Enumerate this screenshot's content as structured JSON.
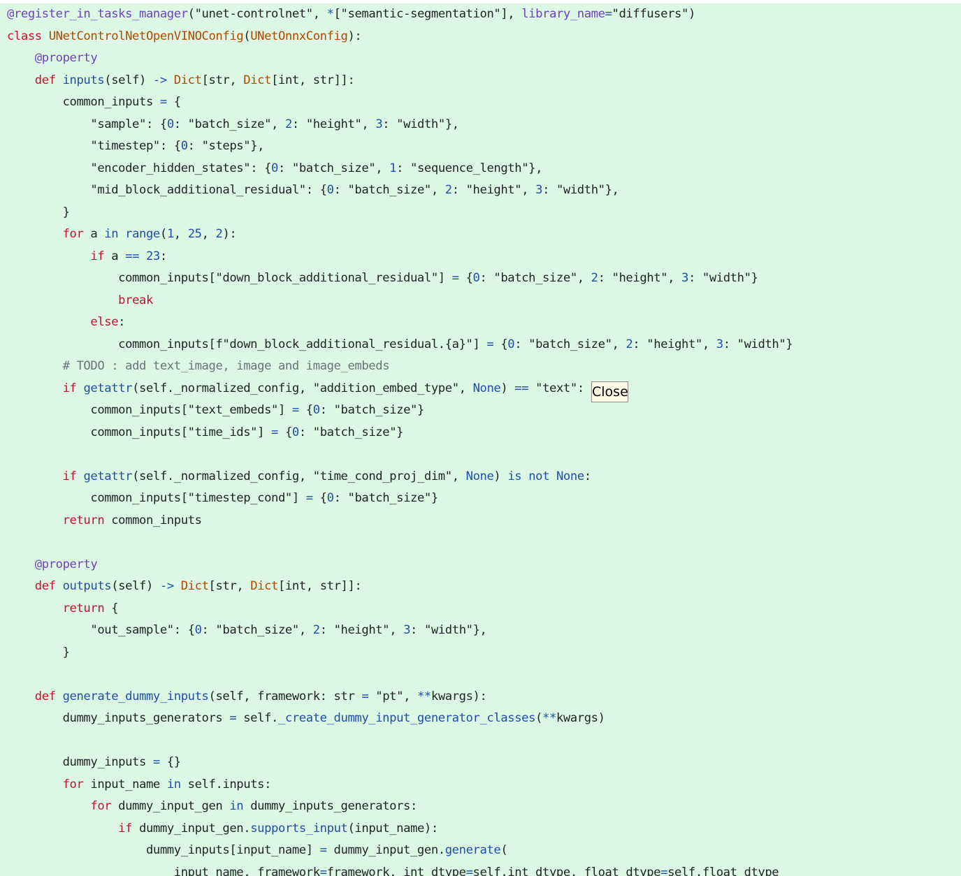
{
  "code": {
    "language": "python",
    "lines": [
      [
        {
          "t": "@register_in_tasks_manager",
          "k": "dec"
        },
        {
          "t": "(",
          "k": "txt"
        },
        {
          "t": "\"unet-controlnet\"",
          "k": "str"
        },
        {
          "t": ", ",
          "k": "txt"
        },
        {
          "t": "*",
          "k": "op"
        },
        {
          "t": "[",
          "k": "txt"
        },
        {
          "t": "\"semantic-segmentation\"",
          "k": "str"
        },
        {
          "t": "], ",
          "k": "txt"
        },
        {
          "t": "library_name",
          "k": "dec"
        },
        {
          "t": "=",
          "k": "op"
        },
        {
          "t": "\"diffusers\"",
          "k": "str"
        },
        {
          "t": ")",
          "k": "txt"
        }
      ],
      [
        {
          "t": "class ",
          "k": "kw"
        },
        {
          "t": "UNetControlNetOpenVINOConfig",
          "k": "cls"
        },
        {
          "t": "(",
          "k": "txt"
        },
        {
          "t": "UNetOnnxConfig",
          "k": "cls"
        },
        {
          "t": "):",
          "k": "txt"
        }
      ],
      [
        {
          "t": "    ",
          "k": "txt"
        },
        {
          "t": "@property",
          "k": "dec"
        }
      ],
      [
        {
          "t": "    ",
          "k": "txt"
        },
        {
          "t": "def ",
          "k": "kw"
        },
        {
          "t": "inputs",
          "k": "bi"
        },
        {
          "t": "(self) ",
          "k": "txt"
        },
        {
          "t": "->",
          "k": "op"
        },
        {
          "t": " ",
          "k": "txt"
        },
        {
          "t": "Dict",
          "k": "cls"
        },
        {
          "t": "[str, ",
          "k": "txt"
        },
        {
          "t": "Dict",
          "k": "cls"
        },
        {
          "t": "[int, str]]:",
          "k": "txt"
        }
      ],
      [
        {
          "t": "        common_inputs ",
          "k": "txt"
        },
        {
          "t": "=",
          "k": "op"
        },
        {
          "t": " {",
          "k": "txt"
        }
      ],
      [
        {
          "t": "            ",
          "k": "txt"
        },
        {
          "t": "\"sample\"",
          "k": "str"
        },
        {
          "t": ": {",
          "k": "txt"
        },
        {
          "t": "0",
          "k": "num"
        },
        {
          "t": ": ",
          "k": "txt"
        },
        {
          "t": "\"batch_size\"",
          "k": "str"
        },
        {
          "t": ", ",
          "k": "txt"
        },
        {
          "t": "2",
          "k": "num"
        },
        {
          "t": ": ",
          "k": "txt"
        },
        {
          "t": "\"height\"",
          "k": "str"
        },
        {
          "t": ", ",
          "k": "txt"
        },
        {
          "t": "3",
          "k": "num"
        },
        {
          "t": ": ",
          "k": "txt"
        },
        {
          "t": "\"width\"",
          "k": "str"
        },
        {
          "t": "},",
          "k": "txt"
        }
      ],
      [
        {
          "t": "            ",
          "k": "txt"
        },
        {
          "t": "\"timestep\"",
          "k": "str"
        },
        {
          "t": ": {",
          "k": "txt"
        },
        {
          "t": "0",
          "k": "num"
        },
        {
          "t": ": ",
          "k": "txt"
        },
        {
          "t": "\"steps\"",
          "k": "str"
        },
        {
          "t": "},",
          "k": "txt"
        }
      ],
      [
        {
          "t": "            ",
          "k": "txt"
        },
        {
          "t": "\"encoder_hidden_states\"",
          "k": "str"
        },
        {
          "t": ": {",
          "k": "txt"
        },
        {
          "t": "0",
          "k": "num"
        },
        {
          "t": ": ",
          "k": "txt"
        },
        {
          "t": "\"batch_size\"",
          "k": "str"
        },
        {
          "t": ", ",
          "k": "txt"
        },
        {
          "t": "1",
          "k": "num"
        },
        {
          "t": ": ",
          "k": "txt"
        },
        {
          "t": "\"sequence_length\"",
          "k": "str"
        },
        {
          "t": "},",
          "k": "txt"
        }
      ],
      [
        {
          "t": "            ",
          "k": "txt"
        },
        {
          "t": "\"mid_block_additional_residual\"",
          "k": "str"
        },
        {
          "t": ": {",
          "k": "txt"
        },
        {
          "t": "0",
          "k": "num"
        },
        {
          "t": ": ",
          "k": "txt"
        },
        {
          "t": "\"batch_size\"",
          "k": "str"
        },
        {
          "t": ", ",
          "k": "txt"
        },
        {
          "t": "2",
          "k": "num"
        },
        {
          "t": ": ",
          "k": "txt"
        },
        {
          "t": "\"height\"",
          "k": "str"
        },
        {
          "t": ", ",
          "k": "txt"
        },
        {
          "t": "3",
          "k": "num"
        },
        {
          "t": ": ",
          "k": "txt"
        },
        {
          "t": "\"width\"",
          "k": "str"
        },
        {
          "t": "},",
          "k": "txt"
        }
      ],
      [
        {
          "t": "        }",
          "k": "txt"
        }
      ],
      [
        {
          "t": "        ",
          "k": "txt"
        },
        {
          "t": "for",
          "k": "kw"
        },
        {
          "t": " a ",
          "k": "txt"
        },
        {
          "t": "in",
          "k": "op"
        },
        {
          "t": " ",
          "k": "txt"
        },
        {
          "t": "range",
          "k": "bi"
        },
        {
          "t": "(",
          "k": "txt"
        },
        {
          "t": "1",
          "k": "num"
        },
        {
          "t": ", ",
          "k": "txt"
        },
        {
          "t": "25",
          "k": "num"
        },
        {
          "t": ", ",
          "k": "txt"
        },
        {
          "t": "2",
          "k": "num"
        },
        {
          "t": "):",
          "k": "txt"
        }
      ],
      [
        {
          "t": "            ",
          "k": "txt"
        },
        {
          "t": "if",
          "k": "kw"
        },
        {
          "t": " a ",
          "k": "txt"
        },
        {
          "t": "==",
          "k": "op"
        },
        {
          "t": " ",
          "k": "txt"
        },
        {
          "t": "23",
          "k": "num"
        },
        {
          "t": ":",
          "k": "txt"
        }
      ],
      [
        {
          "t": "                common_inputs[",
          "k": "txt"
        },
        {
          "t": "\"down_block_additional_residual\"",
          "k": "str"
        },
        {
          "t": "] ",
          "k": "txt"
        },
        {
          "t": "=",
          "k": "op"
        },
        {
          "t": " {",
          "k": "txt"
        },
        {
          "t": "0",
          "k": "num"
        },
        {
          "t": ": ",
          "k": "txt"
        },
        {
          "t": "\"batch_size\"",
          "k": "str"
        },
        {
          "t": ", ",
          "k": "txt"
        },
        {
          "t": "2",
          "k": "num"
        },
        {
          "t": ": ",
          "k": "txt"
        },
        {
          "t": "\"height\"",
          "k": "str"
        },
        {
          "t": ", ",
          "k": "txt"
        },
        {
          "t": "3",
          "k": "num"
        },
        {
          "t": ": ",
          "k": "txt"
        },
        {
          "t": "\"width\"",
          "k": "str"
        },
        {
          "t": "}",
          "k": "txt"
        }
      ],
      [
        {
          "t": "                ",
          "k": "txt"
        },
        {
          "t": "break",
          "k": "kw"
        }
      ],
      [
        {
          "t": "            ",
          "k": "txt"
        },
        {
          "t": "else",
          "k": "kw"
        },
        {
          "t": ":",
          "k": "txt"
        }
      ],
      [
        {
          "t": "                common_inputs[",
          "k": "txt"
        },
        {
          "t": "f\"down_block_additional_residual.{a}\"",
          "k": "str"
        },
        {
          "t": "] ",
          "k": "txt"
        },
        {
          "t": "=",
          "k": "op"
        },
        {
          "t": " {",
          "k": "txt"
        },
        {
          "t": "0",
          "k": "num"
        },
        {
          "t": ": ",
          "k": "txt"
        },
        {
          "t": "\"batch_size\"",
          "k": "str"
        },
        {
          "t": ", ",
          "k": "txt"
        },
        {
          "t": "2",
          "k": "num"
        },
        {
          "t": ": ",
          "k": "txt"
        },
        {
          "t": "\"height\"",
          "k": "str"
        },
        {
          "t": ", ",
          "k": "txt"
        },
        {
          "t": "3",
          "k": "num"
        },
        {
          "t": ": ",
          "k": "txt"
        },
        {
          "t": "\"width\"",
          "k": "str"
        },
        {
          "t": "}",
          "k": "txt"
        }
      ],
      [
        {
          "t": "        ",
          "k": "txt"
        },
        {
          "t": "# TODO : add text_image, image and image_embeds",
          "k": "cmt"
        }
      ],
      [
        {
          "t": "        ",
          "k": "txt"
        },
        {
          "t": "if",
          "k": "kw"
        },
        {
          "t": " ",
          "k": "txt"
        },
        {
          "t": "getattr",
          "k": "bi"
        },
        {
          "t": "(self._normalized_config, ",
          "k": "txt"
        },
        {
          "t": "\"addition_embed_type\"",
          "k": "str"
        },
        {
          "t": ", ",
          "k": "txt"
        },
        {
          "t": "None",
          "k": "bi"
        },
        {
          "t": ") ",
          "k": "txt"
        },
        {
          "t": "==",
          "k": "op"
        },
        {
          "t": " ",
          "k": "txt"
        },
        {
          "t": "\"text\"",
          "k": "str"
        },
        {
          "t": ":",
          "k": "txt"
        }
      ],
      [
        {
          "t": "            common_inputs[",
          "k": "txt"
        },
        {
          "t": "\"text_embeds\"",
          "k": "str"
        },
        {
          "t": "] ",
          "k": "txt"
        },
        {
          "t": "=",
          "k": "op"
        },
        {
          "t": " {",
          "k": "txt"
        },
        {
          "t": "0",
          "k": "num"
        },
        {
          "t": ": ",
          "k": "txt"
        },
        {
          "t": "\"batch_size\"",
          "k": "str"
        },
        {
          "t": "}",
          "k": "txt"
        }
      ],
      [
        {
          "t": "            common_inputs[",
          "k": "txt"
        },
        {
          "t": "\"time_ids\"",
          "k": "str"
        },
        {
          "t": "] ",
          "k": "txt"
        },
        {
          "t": "=",
          "k": "op"
        },
        {
          "t": " {",
          "k": "txt"
        },
        {
          "t": "0",
          "k": "num"
        },
        {
          "t": ": ",
          "k": "txt"
        },
        {
          "t": "\"batch_size\"",
          "k": "str"
        },
        {
          "t": "}",
          "k": "txt"
        }
      ],
      [],
      [
        {
          "t": "        ",
          "k": "txt"
        },
        {
          "t": "if",
          "k": "kw"
        },
        {
          "t": " ",
          "k": "txt"
        },
        {
          "t": "getattr",
          "k": "bi"
        },
        {
          "t": "(self._normalized_config, ",
          "k": "txt"
        },
        {
          "t": "\"time_cond_proj_dim\"",
          "k": "str"
        },
        {
          "t": ", ",
          "k": "txt"
        },
        {
          "t": "None",
          "k": "bi"
        },
        {
          "t": ") ",
          "k": "txt"
        },
        {
          "t": "is",
          "k": "op"
        },
        {
          "t": " ",
          "k": "txt"
        },
        {
          "t": "not",
          "k": "op"
        },
        {
          "t": " ",
          "k": "txt"
        },
        {
          "t": "None",
          "k": "bi"
        },
        {
          "t": ":",
          "k": "txt"
        }
      ],
      [
        {
          "t": "            common_inputs[",
          "k": "txt"
        },
        {
          "t": "\"timestep_cond\"",
          "k": "str"
        },
        {
          "t": "] ",
          "k": "txt"
        },
        {
          "t": "=",
          "k": "op"
        },
        {
          "t": " {",
          "k": "txt"
        },
        {
          "t": "0",
          "k": "num"
        },
        {
          "t": ": ",
          "k": "txt"
        },
        {
          "t": "\"batch_size\"",
          "k": "str"
        },
        {
          "t": "}",
          "k": "txt"
        }
      ],
      [
        {
          "t": "        ",
          "k": "txt"
        },
        {
          "t": "return",
          "k": "kw"
        },
        {
          "t": " common_inputs",
          "k": "txt"
        }
      ],
      [],
      [
        {
          "t": "    ",
          "k": "txt"
        },
        {
          "t": "@property",
          "k": "dec"
        }
      ],
      [
        {
          "t": "    ",
          "k": "txt"
        },
        {
          "t": "def ",
          "k": "kw"
        },
        {
          "t": "outputs",
          "k": "bi"
        },
        {
          "t": "(self) ",
          "k": "txt"
        },
        {
          "t": "->",
          "k": "op"
        },
        {
          "t": " ",
          "k": "txt"
        },
        {
          "t": "Dict",
          "k": "cls"
        },
        {
          "t": "[str, ",
          "k": "txt"
        },
        {
          "t": "Dict",
          "k": "cls"
        },
        {
          "t": "[int, str]]:",
          "k": "txt"
        }
      ],
      [
        {
          "t": "        ",
          "k": "txt"
        },
        {
          "t": "return",
          "k": "kw"
        },
        {
          "t": " {",
          "k": "txt"
        }
      ],
      [
        {
          "t": "            ",
          "k": "txt"
        },
        {
          "t": "\"out_sample\"",
          "k": "str"
        },
        {
          "t": ": {",
          "k": "txt"
        },
        {
          "t": "0",
          "k": "num"
        },
        {
          "t": ": ",
          "k": "txt"
        },
        {
          "t": "\"batch_size\"",
          "k": "str"
        },
        {
          "t": ", ",
          "k": "txt"
        },
        {
          "t": "2",
          "k": "num"
        },
        {
          "t": ": ",
          "k": "txt"
        },
        {
          "t": "\"height\"",
          "k": "str"
        },
        {
          "t": ", ",
          "k": "txt"
        },
        {
          "t": "3",
          "k": "num"
        },
        {
          "t": ": ",
          "k": "txt"
        },
        {
          "t": "\"width\"",
          "k": "str"
        },
        {
          "t": "},",
          "k": "txt"
        }
      ],
      [
        {
          "t": "        }",
          "k": "txt"
        }
      ],
      [],
      [
        {
          "t": "    ",
          "k": "txt"
        },
        {
          "t": "def ",
          "k": "kw"
        },
        {
          "t": "generate_dummy_inputs",
          "k": "bi"
        },
        {
          "t": "(self, framework: str ",
          "k": "txt"
        },
        {
          "t": "=",
          "k": "op"
        },
        {
          "t": " ",
          "k": "txt"
        },
        {
          "t": "\"pt\"",
          "k": "str"
        },
        {
          "t": ", ",
          "k": "txt"
        },
        {
          "t": "**",
          "k": "op"
        },
        {
          "t": "kwargs):",
          "k": "txt"
        }
      ],
      [
        {
          "t": "        dummy_inputs_generators ",
          "k": "txt"
        },
        {
          "t": "=",
          "k": "op"
        },
        {
          "t": " self.",
          "k": "txt"
        },
        {
          "t": "_create_dummy_input_generator_classes",
          "k": "bi"
        },
        {
          "t": "(",
          "k": "txt"
        },
        {
          "t": "**",
          "k": "op"
        },
        {
          "t": "kwargs)",
          "k": "txt"
        }
      ],
      [],
      [
        {
          "t": "        dummy_inputs ",
          "k": "txt"
        },
        {
          "t": "=",
          "k": "op"
        },
        {
          "t": " {}",
          "k": "txt"
        }
      ],
      [
        {
          "t": "        ",
          "k": "txt"
        },
        {
          "t": "for",
          "k": "kw"
        },
        {
          "t": " input_name ",
          "k": "txt"
        },
        {
          "t": "in",
          "k": "op"
        },
        {
          "t": " self.inputs:",
          "k": "txt"
        }
      ],
      [
        {
          "t": "            ",
          "k": "txt"
        },
        {
          "t": "for",
          "k": "kw"
        },
        {
          "t": " dummy_input_gen ",
          "k": "txt"
        },
        {
          "t": "in",
          "k": "op"
        },
        {
          "t": " dummy_inputs_generators:",
          "k": "txt"
        }
      ],
      [
        {
          "t": "                ",
          "k": "txt"
        },
        {
          "t": "if",
          "k": "kw"
        },
        {
          "t": " dummy_input_gen.",
          "k": "txt"
        },
        {
          "t": "supports_input",
          "k": "bi"
        },
        {
          "t": "(input_name):",
          "k": "txt"
        }
      ],
      [
        {
          "t": "                    dummy_inputs[input_name] ",
          "k": "txt"
        },
        {
          "t": "=",
          "k": "op"
        },
        {
          "t": " dummy_input_gen.",
          "k": "txt"
        },
        {
          "t": "generate",
          "k": "bi"
        },
        {
          "t": "(",
          "k": "txt"
        }
      ],
      [
        {
          "t": "                        input_name, framework",
          "k": "txt"
        },
        {
          "t": "=",
          "k": "op"
        },
        {
          "t": "framework, int_dtype",
          "k": "txt"
        },
        {
          "t": "=",
          "k": "op"
        },
        {
          "t": "self.int_dtype, float_dtype",
          "k": "txt"
        },
        {
          "t": "=",
          "k": "op"
        },
        {
          "t": "self.float_dtype",
          "k": "txt"
        }
      ]
    ]
  },
  "tooltip": {
    "label": "Close"
  },
  "colors": {
    "background": "#dcf7e3",
    "keyword": "#c8102e",
    "builtin": "#1f4fa8",
    "decorator": "#6f42c1",
    "class_name": "#b04a00",
    "comment": "#6a737d",
    "text": "#1f2328"
  }
}
